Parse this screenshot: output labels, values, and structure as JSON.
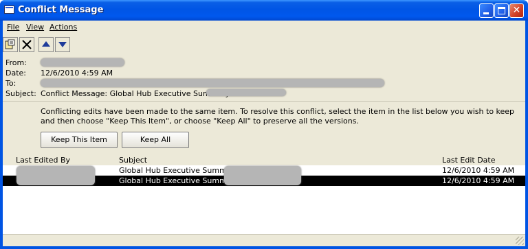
{
  "window": {
    "title": "Conflict Message"
  },
  "menu": {
    "file": "File",
    "view": "View",
    "actions": "Actions"
  },
  "fields": {
    "from_label": "From:",
    "date_label": "Date:",
    "date_value": "12/6/2010 4:59 AM",
    "to_label": "To:",
    "subject_label": "Subject:",
    "subject_value": "Conflict Message: Global Hub Executive Summary"
  },
  "message": "Conflicting edits have been made to the same item. To resolve this conflict, select the item in the list below you wish to keep and then choose \"Keep This Item\", or choose \"Keep All\" to preserve all the versions.",
  "buttons": {
    "keep_item": "Keep This Item",
    "keep_all": "Keep All"
  },
  "list": {
    "headers": {
      "last_edited_by": "Last Edited By",
      "subject": "Subject",
      "last_edit_date": "Last Edit Date"
    },
    "rows": [
      {
        "subject": "Global Hub Executive Summary",
        "date": "12/6/2010 4:59 AM",
        "selected": false
      },
      {
        "subject": "Global Hub Executive Summary",
        "date": "12/6/2010 4:59 AM",
        "selected": true
      }
    ]
  },
  "icons": {
    "app": "message-window-icon",
    "open": "open-item-icon",
    "delete": "delete-x-icon",
    "up": "up-arrow-icon",
    "down": "down-arrow-icon"
  },
  "colors": {
    "titlebar": "#0055e5",
    "client": "#ece9d8",
    "selection": "#000000"
  }
}
